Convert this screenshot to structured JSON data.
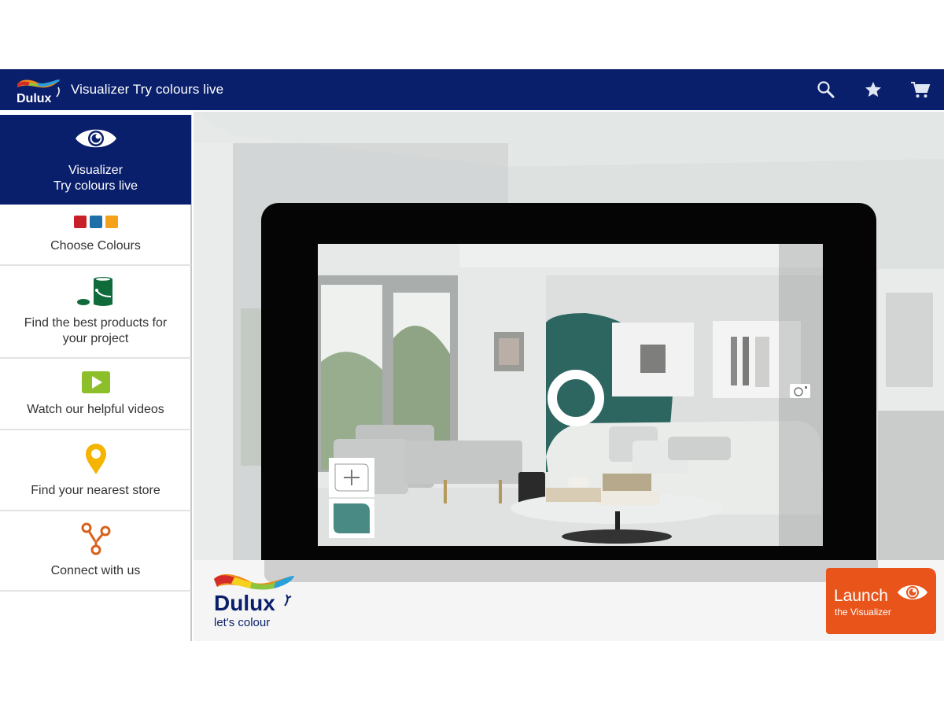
{
  "app": {
    "brand": "Dulux",
    "title": "Visualizer Try colours live",
    "brand_color": "#0a1f6b"
  },
  "header_actions": [
    {
      "name": "search",
      "icon": "search-icon"
    },
    {
      "name": "favourites",
      "icon": "star-icon"
    },
    {
      "name": "cart",
      "icon": "cart-icon"
    }
  ],
  "sidebar": {
    "items": [
      {
        "id": "visualizer",
        "line1": "Visualizer",
        "line2": "Try colours live",
        "icon": "eye-icon",
        "active": true
      },
      {
        "id": "choose-colours",
        "line1": "Choose Colours",
        "line2": "",
        "icon": "colour-swatches-icon",
        "icon_colors": [
          "#c8202a",
          "#1f6fa8",
          "#f5a11a"
        ]
      },
      {
        "id": "find-products",
        "line1": "Find the best products for",
        "line2": "your project",
        "icon": "paint-can-icon",
        "icon_color": "#0f6b3a"
      },
      {
        "id": "watch-videos",
        "line1": "Watch our helpful videos",
        "line2": "",
        "icon": "play-icon",
        "icon_color": "#8dbf2a"
      },
      {
        "id": "find-store",
        "line1": "Find your nearest store",
        "line2": "",
        "icon": "location-pin-icon",
        "icon_color": "#f5b400"
      },
      {
        "id": "connect",
        "line1": "Connect with us",
        "line2": "",
        "icon": "share-icon",
        "icon_color": "#d9601c"
      }
    ]
  },
  "main": {
    "visualizer_preview": {
      "paint_colour": "#2d6660",
      "swatch_colour": "#4a8a85",
      "tools": [
        "add-button",
        "colour-swatch",
        "camera-button",
        "picker-ring"
      ]
    },
    "footer_brand": {
      "wordmark": "Dulux",
      "tagline": "let's colour"
    },
    "launch_button": {
      "line1": "Launch",
      "line2": "the Visualizer",
      "color": "#e8541a"
    }
  }
}
